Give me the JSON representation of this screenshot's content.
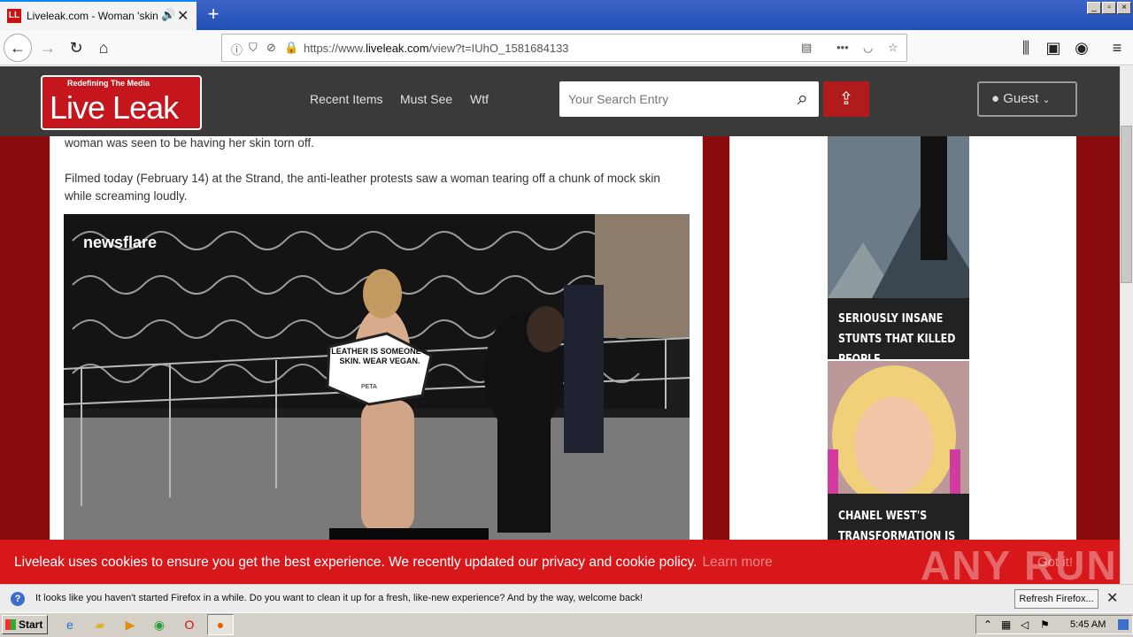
{
  "browser": {
    "tab_title": "Liveleak.com - Woman 'skinned",
    "favicon": "LL",
    "url_prefix": "https://www.",
    "url_domain": "liveleak.com",
    "url_path": "/view?t=IUhO_1581684133",
    "window_buttons": [
      "_",
      "▫",
      "×"
    ]
  },
  "site": {
    "logo_tagline": "Redefining The Media",
    "logo_name": "Live Leak",
    "nav": [
      "Recent Items",
      "Must See",
      "Wtf"
    ],
    "search_placeholder": "Your Search Entry",
    "user_label": "Guest"
  },
  "article": {
    "para1_tail": "woman was seen to be having her skin torn off.",
    "para2": "Filmed today (February 14) at the Strand, the anti-leather protests saw a woman tearing off a chunk of mock skin while screaming loudly.",
    "video_watermark": "newsflare",
    "sign_text": "LEATHER IS SOMEONE'S SKIN. WEAR VEGAN.",
    "sign_brand": "PETA"
  },
  "sidebar": {
    "ad1_caption": "SERIOUSLY INSANE STUNTS THAT KILLED PEOPLE",
    "ad2_caption": "CHANEL WEST'S TRANSFORMATION IS"
  },
  "cookie": {
    "message": "Liveleak uses cookies to ensure you get the best experience. We recently updated our privacy and cookie policy.",
    "learn_more": "Learn more",
    "got_it": "Got it!"
  },
  "watermark": "ANY RUN",
  "notification": {
    "message": "It looks like you haven't started Firefox in a while. Do you want to clean it up for a fresh, like-new experience? And by the way, welcome back!",
    "button": "Refresh Firefox..."
  },
  "taskbar": {
    "start": "Start",
    "clock": "5:45 AM"
  },
  "colors": {
    "brand_red": "#c4161c",
    "header_bg": "#3a3a3a",
    "page_bg": "#8b0c0c",
    "cookie_bg": "#d8171b"
  }
}
